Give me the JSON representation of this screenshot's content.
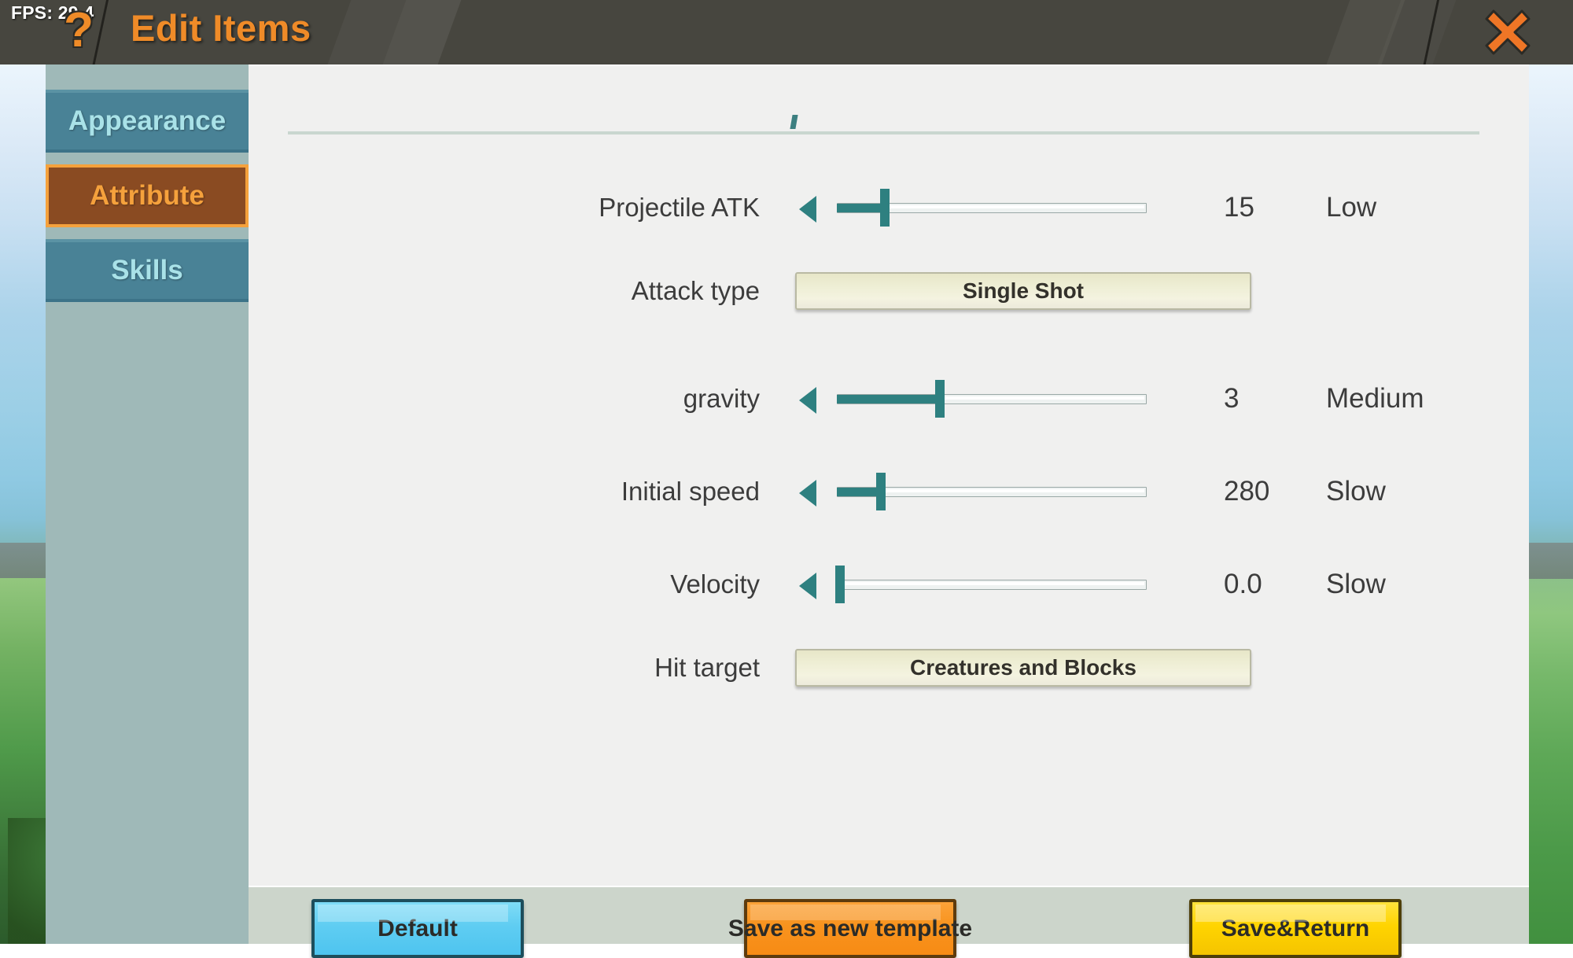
{
  "hud": {
    "fps": "FPS: 29.4",
    "help_icon": "question-mark-icon"
  },
  "header": {
    "title": "Edit Items",
    "close_icon": "close-x-icon",
    "accent_color": "#ef8b28"
  },
  "sidebar": {
    "tabs": [
      {
        "label": "Appearance",
        "active": false
      },
      {
        "label": "Attribute",
        "active": true
      },
      {
        "label": "Skills",
        "active": false
      }
    ],
    "active_color": "#f5a13c",
    "inactive_color": "#498296"
  },
  "main": {
    "rows": [
      {
        "type": "slider",
        "label": "Projectile ATK",
        "value": "15",
        "qualifier": "Low",
        "fill_percent": 14,
        "left_arrow_icon": "triangle-left-icon",
        "right_arrow_icon": "triangle-right-icon"
      },
      {
        "type": "option",
        "label": "Attack type",
        "value": "Single Shot"
      },
      {
        "type": "slider",
        "label": "gravity",
        "value": "3",
        "qualifier": "Medium",
        "fill_percent": 30,
        "left_arrow_icon": "triangle-left-icon",
        "right_arrow_icon": "triangle-right-icon"
      },
      {
        "type": "slider",
        "label": "Initial speed",
        "value": "280",
        "qualifier": "Slow",
        "fill_percent": 13,
        "left_arrow_icon": "triangle-left-icon",
        "right_arrow_icon": "triangle-right-icon"
      },
      {
        "type": "slider",
        "label": "Velocity",
        "value": "0.0",
        "qualifier": "Slow",
        "fill_percent": 0,
        "left_arrow_icon": "triangle-left-icon",
        "right_arrow_icon": "triangle-right-icon"
      },
      {
        "type": "option",
        "label": "Hit target",
        "value": "Creatures and Blocks"
      }
    ],
    "slider_track_color": "#2e8080"
  },
  "footer": {
    "buttons": [
      {
        "label": "Default",
        "color": "#4ec4ef"
      },
      {
        "label": "Save as new template",
        "color": "#f8931e"
      },
      {
        "label": "Save&Return",
        "color": "#ffd400"
      }
    ]
  }
}
